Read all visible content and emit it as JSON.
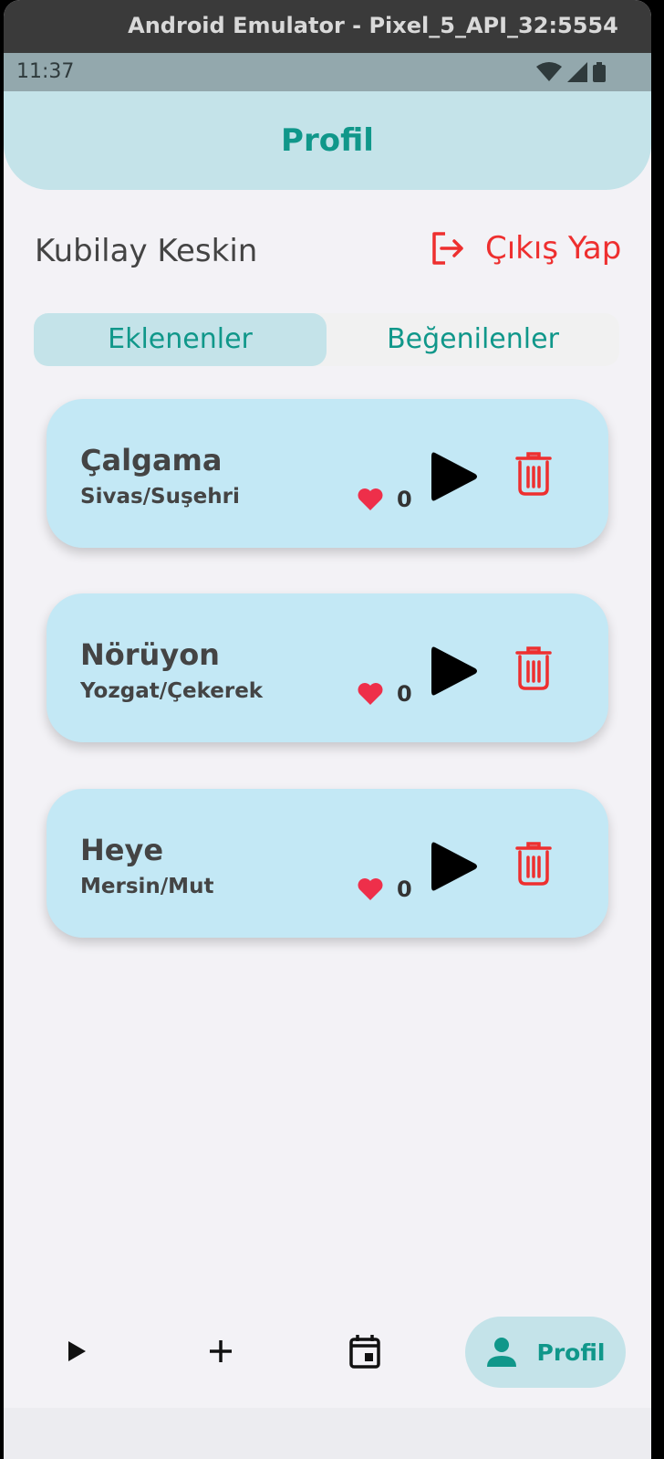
{
  "window": {
    "title": "Android Emulator - Pixel_5_API_32:5554"
  },
  "status": {
    "time": "11:37"
  },
  "appbar": {
    "title": "Profil"
  },
  "profile": {
    "username": "Kubilay Keskin",
    "logout_label": "Çıkış Yap"
  },
  "tabs": [
    {
      "label": "Eklenenler",
      "active": true
    },
    {
      "label": "Beğenilenler",
      "active": false
    }
  ],
  "songs": [
    {
      "name": "Çalgama",
      "place": "Sivas/Suşehri",
      "likes": "0"
    },
    {
      "name": "Nörüyon",
      "place": "Yozgat/Çekerek",
      "likes": "0"
    },
    {
      "name": "Heye",
      "place": "Mersin/Mut",
      "likes": "0"
    }
  ],
  "bottom_nav": {
    "items": [
      {
        "icon": "play-icon"
      },
      {
        "icon": "plus-icon"
      },
      {
        "icon": "calendar-icon"
      },
      {
        "icon": "person-icon",
        "label": "Profil",
        "active": true
      }
    ]
  },
  "colors": {
    "accent": "#10978a",
    "danger": "#ee2f2f",
    "card": "#c3e8f5",
    "appbar": "#c4e3e9"
  }
}
